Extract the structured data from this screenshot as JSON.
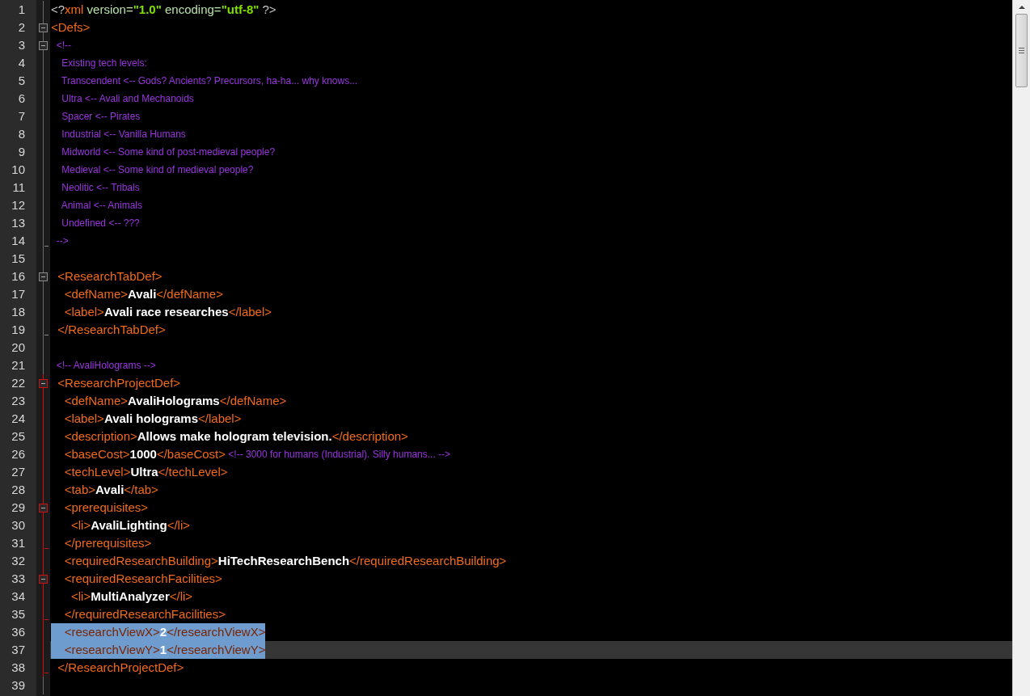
{
  "editor": {
    "lines": [
      {
        "number": "1",
        "tokens": [
          {
            "kind": "punct",
            "text": "<?"
          },
          {
            "kind": "pi",
            "text": "xml"
          },
          {
            "kind": "attr",
            "text": " version="
          },
          {
            "kind": "string",
            "text": "\"1.0\""
          },
          {
            "kind": "attr",
            "text": " encoding="
          },
          {
            "kind": "string",
            "text": "\"utf-8\""
          },
          {
            "kind": "punct",
            "text": " ?>"
          }
        ]
      },
      {
        "number": "2",
        "fold_start": true,
        "tokens": [
          {
            "kind": "tag",
            "text": "<Defs>"
          }
        ]
      },
      {
        "number": "3",
        "fold_start": true,
        "tokens": [
          {
            "kind": "comment",
            "text": "  <!--"
          }
        ]
      },
      {
        "number": "4",
        "tokens": [
          {
            "kind": "comment",
            "text": "    Existing tech levels:"
          }
        ]
      },
      {
        "number": "5",
        "tokens": [
          {
            "kind": "comment",
            "text": "    Transcendent <-- Gods? Ancients? Precursors, ha-ha... why knows..."
          }
        ]
      },
      {
        "number": "6",
        "tokens": [
          {
            "kind": "comment",
            "text": "    Ultra <-- Avali and Mechanoids"
          }
        ]
      },
      {
        "number": "7",
        "tokens": [
          {
            "kind": "comment",
            "text": "    Spacer <-- Pirates"
          }
        ]
      },
      {
        "number": "8",
        "tokens": [
          {
            "kind": "comment",
            "text": "    Industrial <-- Vanilla Humans"
          }
        ]
      },
      {
        "number": "9",
        "tokens": [
          {
            "kind": "comment",
            "text": "    Midworld <-- Some kind of post-medieval people?"
          }
        ]
      },
      {
        "number": "10",
        "tokens": [
          {
            "kind": "comment",
            "text": "    Medieval <-- Some kind of medieval people?"
          }
        ]
      },
      {
        "number": "11",
        "tokens": [
          {
            "kind": "comment",
            "text": "    Neolitic <-- Tribals"
          }
        ]
      },
      {
        "number": "12",
        "tokens": [
          {
            "kind": "comment",
            "text": "    Animal <-- Animals"
          }
        ]
      },
      {
        "number": "13",
        "tokens": [
          {
            "kind": "comment",
            "text": "    Undefined <-- ???"
          }
        ]
      },
      {
        "number": "14",
        "fold_end": true,
        "tokens": [
          {
            "kind": "comment",
            "text": "  -->"
          }
        ]
      },
      {
        "number": "15"
      },
      {
        "number": "16",
        "fold_start": true,
        "tokens": [
          {
            "kind": "tag",
            "text": "  <ResearchTabDef>"
          }
        ]
      },
      {
        "number": "17",
        "tokens": [
          {
            "kind": "tag",
            "text": "    <defName>"
          },
          {
            "kind": "text",
            "text": "Avali"
          },
          {
            "kind": "tag",
            "text": "</defName>"
          }
        ]
      },
      {
        "number": "18",
        "tokens": [
          {
            "kind": "tag",
            "text": "    <label>"
          },
          {
            "kind": "text",
            "text": "Avali race researches"
          },
          {
            "kind": "tag",
            "text": "</label>"
          }
        ]
      },
      {
        "number": "19",
        "fold_end": true,
        "tokens": [
          {
            "kind": "tag",
            "text": "  </ResearchTabDef>"
          }
        ]
      },
      {
        "number": "20"
      },
      {
        "number": "21",
        "tokens": [
          {
            "kind": "comment",
            "text": "  <!-- AvaliHolograms -->"
          }
        ]
      },
      {
        "number": "22",
        "fold_start": true,
        "active": true,
        "tokens": [
          {
            "kind": "tag",
            "text": "  <ResearchProjectDef>"
          }
        ]
      },
      {
        "number": "23",
        "active": true,
        "tokens": [
          {
            "kind": "tag",
            "text": "    <defName>"
          },
          {
            "kind": "text",
            "text": "AvaliHolograms"
          },
          {
            "kind": "tag",
            "text": "</defName>"
          }
        ]
      },
      {
        "number": "24",
        "active": true,
        "tokens": [
          {
            "kind": "tag",
            "text": "    <label>"
          },
          {
            "kind": "text",
            "text": "Avali holograms"
          },
          {
            "kind": "tag",
            "text": "</label>"
          }
        ]
      },
      {
        "number": "25",
        "active": true,
        "tokens": [
          {
            "kind": "tag",
            "text": "    <description>"
          },
          {
            "kind": "text",
            "text": "Allows make hologram television."
          },
          {
            "kind": "tag",
            "text": "</description>"
          }
        ]
      },
      {
        "number": "26",
        "active": true,
        "tokens": [
          {
            "kind": "tag",
            "text": "    <baseCost>"
          },
          {
            "kind": "text",
            "text": "1000"
          },
          {
            "kind": "tag",
            "text": "</baseCost>"
          },
          {
            "kind": "comment",
            "text": " <!-- 3000 for humans (Industrial). Silly humans... -->"
          }
        ]
      },
      {
        "number": "27",
        "active": true,
        "tokens": [
          {
            "kind": "tag",
            "text": "    <techLevel>"
          },
          {
            "kind": "text",
            "text": "Ultra"
          },
          {
            "kind": "tag",
            "text": "</techLevel>"
          }
        ]
      },
      {
        "number": "28",
        "active": true,
        "tokens": [
          {
            "kind": "tag",
            "text": "    <tab>"
          },
          {
            "kind": "text",
            "text": "Avali"
          },
          {
            "kind": "tag",
            "text": "</tab>"
          }
        ]
      },
      {
        "number": "29",
        "fold_start": true,
        "active": true,
        "tokens": [
          {
            "kind": "tag",
            "text": "    <prerequisites>"
          }
        ]
      },
      {
        "number": "30",
        "active": true,
        "tokens": [
          {
            "kind": "tag",
            "text": "      <li>"
          },
          {
            "kind": "text",
            "text": "AvaliLighting"
          },
          {
            "kind": "tag",
            "text": "</li>"
          }
        ]
      },
      {
        "number": "31",
        "fold_end": true,
        "active": true,
        "tokens": [
          {
            "kind": "tag",
            "text": "    </prerequisites>"
          }
        ]
      },
      {
        "number": "32",
        "active": true,
        "tokens": [
          {
            "kind": "tag",
            "text": "    <requiredResearchBuilding>"
          },
          {
            "kind": "text",
            "text": "HiTechResearchBench"
          },
          {
            "kind": "tag",
            "text": "</requiredResearchBuilding>"
          }
        ]
      },
      {
        "number": "33",
        "fold_start": true,
        "active": true,
        "tokens": [
          {
            "kind": "tag",
            "text": "    <requiredResearchFacilities>"
          }
        ]
      },
      {
        "number": "34",
        "active": true,
        "tokens": [
          {
            "kind": "tag",
            "text": "      <li>"
          },
          {
            "kind": "text",
            "text": "MultiAnalyzer"
          },
          {
            "kind": "tag",
            "text": "</li>"
          }
        ]
      },
      {
        "number": "35",
        "fold_end": true,
        "active": true,
        "tokens": [
          {
            "kind": "tag",
            "text": "    </requiredResearchFacilities>"
          }
        ]
      },
      {
        "number": "36",
        "active": true,
        "selected": true,
        "tokens": [
          {
            "kind": "tag",
            "text": "    <researchViewX>"
          },
          {
            "kind": "text",
            "text": "2"
          },
          {
            "kind": "tag",
            "text": "</researchViewX>"
          }
        ]
      },
      {
        "number": "37",
        "active": true,
        "selected": true,
        "current": true,
        "tokens": [
          {
            "kind": "tag",
            "text": "    <researchViewY>"
          },
          {
            "kind": "text",
            "text": "1"
          },
          {
            "kind": "tag",
            "text": "</researchViewY>"
          }
        ]
      },
      {
        "number": "38",
        "fold_end": true,
        "active": true,
        "tokens": [
          {
            "kind": "tag",
            "text": "  </ResearchProjectDef>"
          }
        ]
      },
      {
        "number": "39"
      }
    ]
  }
}
